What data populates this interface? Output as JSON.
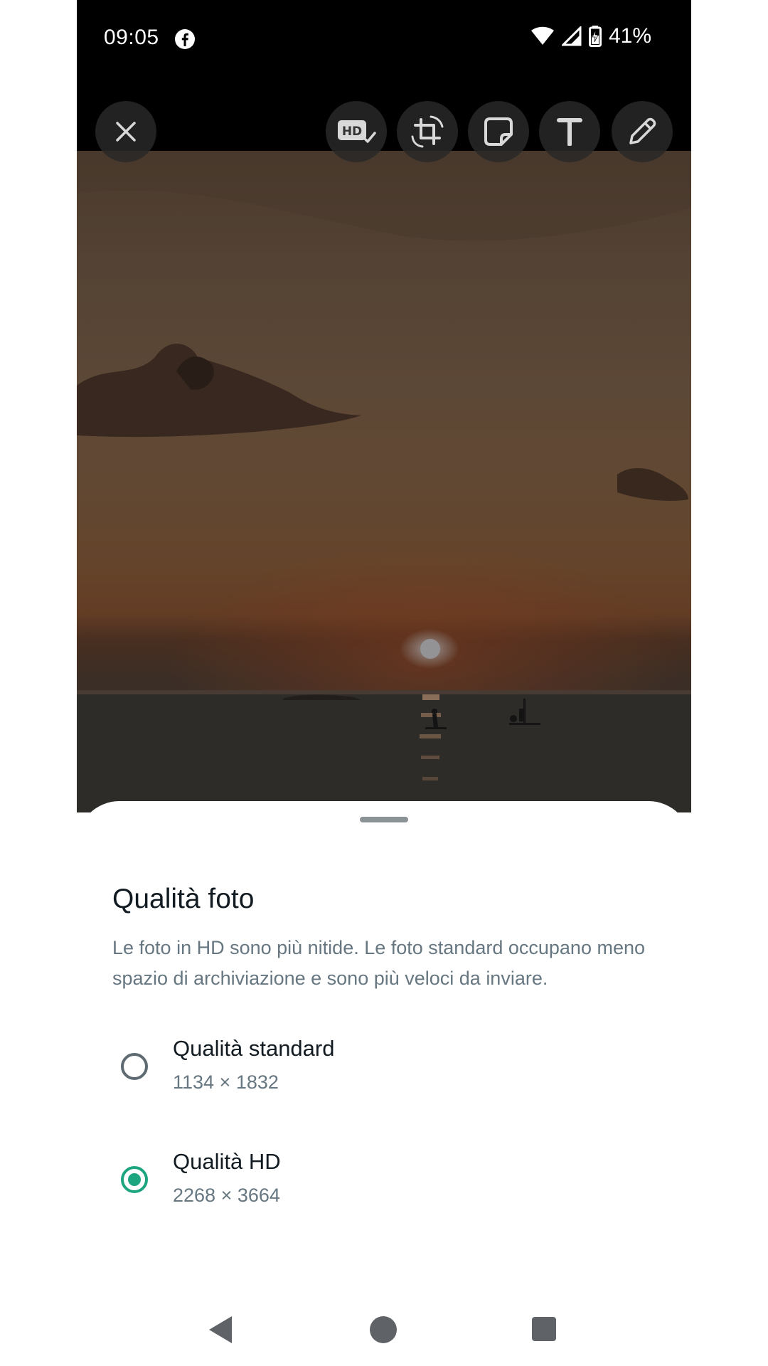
{
  "status_bar": {
    "time": "09:05",
    "battery": "41%",
    "icons": [
      "facebook-icon",
      "wifi-icon",
      "signal-icon",
      "battery-charging-icon"
    ]
  },
  "toolbar": {
    "icons": [
      "close-icon",
      "hd-quality-icon",
      "crop-rotate-icon",
      "sticker-icon",
      "text-icon",
      "pencil-icon"
    ]
  },
  "sheet": {
    "title": "Qualità foto",
    "description": "Le foto in HD sono più nitide. Le foto standard occupano meno spazio di archiviazione e sono più veloci da inviare.",
    "options": [
      {
        "label": "Qualità standard",
        "resolution": "1134 × 1832",
        "selected": false
      },
      {
        "label": "Qualità HD",
        "resolution": "2268 × 3664",
        "selected": true
      }
    ]
  },
  "colors": {
    "accent": "#1da57f",
    "title_text": "#111b21",
    "secondary_text": "#667781"
  },
  "nav_bar": {
    "icons": [
      "back-icon",
      "home-icon",
      "recents-icon"
    ]
  }
}
